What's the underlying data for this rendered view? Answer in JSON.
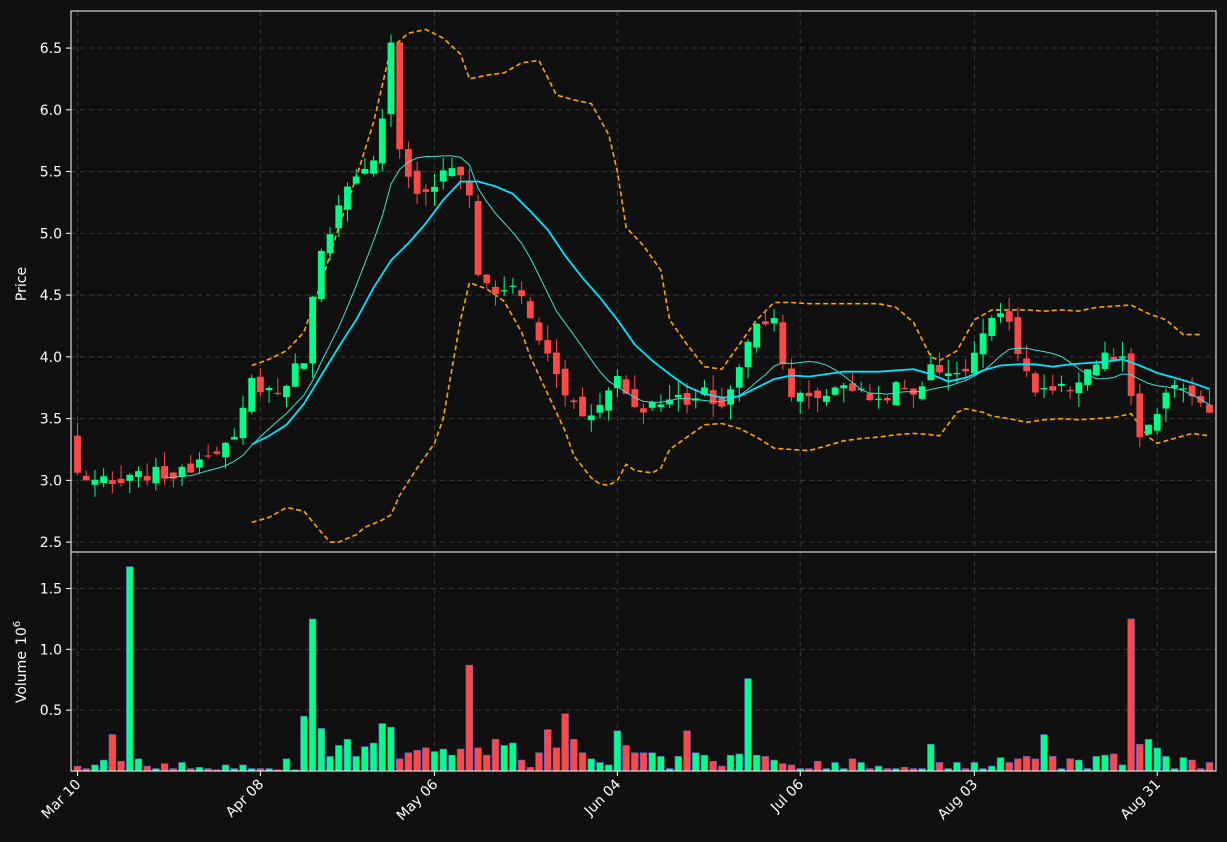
{
  "colors": {
    "background": "#101010",
    "up": "#00ff88",
    "down": "#ff4848",
    "grid": "#3a3a3a",
    "frame": "#ffffff",
    "text": "#ffffff",
    "ma_fast": "#40e0d0",
    "ma_slow": "#00e5ff",
    "bollinger": "#ffa500"
  },
  "chart_data": {
    "type": "candlestick",
    "price_panel": {
      "ylabel": "Price",
      "ylim": [
        2.42,
        6.8
      ],
      "yticks": [
        2.5,
        3.0,
        3.5,
        4.0,
        4.5,
        5.0,
        5.5,
        6.0,
        6.5
      ],
      "ytick_labels": [
        "2.5",
        "3.0",
        "3.5",
        "4.0",
        "4.5",
        "5.0",
        "5.5",
        "6.0",
        "6.5"
      ],
      "grid": true
    },
    "volume_panel": {
      "ylabel": "Volume",
      "ylabel_exponent": "10",
      "ylabel_power": "6",
      "ylim": [
        0,
        1.8
      ],
      "yticks": [
        0.5,
        1.0,
        1.5
      ],
      "ytick_labels": [
        "0.5",
        "1.0",
        "1.5"
      ],
      "grid": true
    },
    "x_ticks": [
      {
        "index": 0,
        "label": "Mar 10"
      },
      {
        "index": 21,
        "label": "Apr 08"
      },
      {
        "index": 41,
        "label": "May 06"
      },
      {
        "index": 62,
        "label": "Jun 04"
      },
      {
        "index": 83,
        "label": "Jul 06"
      },
      {
        "index": 103,
        "label": "Aug 03"
      },
      {
        "index": 124,
        "label": "Aug 31"
      }
    ],
    "n_bars": 131,
    "keypoints": {
      "close": [
        [
          0,
          3.05
        ],
        [
          4,
          2.95
        ],
        [
          8,
          3.05
        ],
        [
          12,
          3.05
        ],
        [
          15,
          3.25
        ],
        [
          18,
          3.3
        ],
        [
          20,
          3.8
        ],
        [
          23,
          3.7
        ],
        [
          26,
          4.0
        ],
        [
          28,
          4.9
        ],
        [
          31,
          5.35
        ],
        [
          34,
          5.55
        ],
        [
          35,
          5.9
        ],
        [
          36,
          6.6
        ],
        [
          37,
          5.7
        ],
        [
          39,
          5.3
        ],
        [
          41,
          5.4
        ],
        [
          43,
          5.55
        ],
        [
          45,
          5.3
        ],
        [
          46,
          4.7
        ],
        [
          48,
          4.5
        ],
        [
          50,
          4.6
        ],
        [
          52,
          4.3
        ],
        [
          54,
          4.0
        ],
        [
          56,
          3.7
        ],
        [
          58,
          3.55
        ],
        [
          60,
          3.6
        ],
        [
          62,
          3.85
        ],
        [
          64,
          3.6
        ],
        [
          66,
          3.6
        ],
        [
          68,
          3.7
        ],
        [
          70,
          3.6
        ],
        [
          72,
          3.7
        ],
        [
          74,
          3.6
        ],
        [
          76,
          3.9
        ],
        [
          78,
          4.3
        ],
        [
          80,
          4.3
        ],
        [
          82,
          3.7
        ],
        [
          84,
          3.65
        ],
        [
          86,
          3.7
        ],
        [
          88,
          3.8
        ],
        [
          90,
          3.7
        ],
        [
          92,
          3.65
        ],
        [
          94,
          3.75
        ],
        [
          96,
          3.7
        ],
        [
          98,
          3.9
        ],
        [
          100,
          3.9
        ],
        [
          102,
          3.85
        ],
        [
          104,
          4.25
        ],
        [
          106,
          4.4
        ],
        [
          108,
          4.05
        ],
        [
          110,
          3.7
        ],
        [
          112,
          3.7
        ],
        [
          114,
          3.75
        ],
        [
          116,
          3.9
        ],
        [
          118,
          4.0
        ],
        [
          120,
          3.95
        ],
        [
          122,
          3.35
        ],
        [
          123,
          3.4
        ],
        [
          124,
          3.55
        ],
        [
          125,
          3.7
        ],
        [
          127,
          3.75
        ],
        [
          128,
          3.7
        ],
        [
          130,
          3.5
        ]
      ],
      "volume_m": [
        [
          0,
          0.04
        ],
        [
          2,
          0.05
        ],
        [
          3,
          0.09
        ],
        [
          4,
          0.3
        ],
        [
          5,
          0.08
        ],
        [
          6,
          1.68
        ],
        [
          7,
          0.1
        ],
        [
          8,
          0.04
        ],
        [
          10,
          0.06
        ],
        [
          12,
          0.07
        ],
        [
          14,
          0.03
        ],
        [
          16,
          0.01
        ],
        [
          17,
          0.05
        ],
        [
          19,
          0.05
        ],
        [
          21,
          0.02
        ],
        [
          23,
          0.01
        ],
        [
          24,
          0.1
        ],
        [
          25,
          0.01
        ],
        [
          26,
          0.45
        ],
        [
          27,
          1.25
        ],
        [
          28,
          0.35
        ],
        [
          29,
          0.12
        ],
        [
          30,
          0.21
        ],
        [
          31,
          0.26
        ],
        [
          32,
          0.12
        ],
        [
          33,
          0.2
        ],
        [
          34,
          0.23
        ],
        [
          35,
          0.39
        ],
        [
          36,
          0.36
        ],
        [
          37,
          0.1
        ],
        [
          38,
          0.15
        ],
        [
          39,
          0.17
        ],
        [
          40,
          0.19
        ],
        [
          41,
          0.16
        ],
        [
          42,
          0.18
        ],
        [
          43,
          0.13
        ],
        [
          44,
          0.18
        ],
        [
          45,
          0.87
        ],
        [
          46,
          0.19
        ],
        [
          47,
          0.13
        ],
        [
          48,
          0.26
        ],
        [
          49,
          0.21
        ],
        [
          50,
          0.23
        ],
        [
          51,
          0.09
        ],
        [
          52,
          0.03
        ],
        [
          53,
          0.15
        ],
        [
          54,
          0.34
        ],
        [
          55,
          0.19
        ],
        [
          56,
          0.47
        ],
        [
          57,
          0.26
        ],
        [
          58,
          0.15
        ],
        [
          59,
          0.1
        ],
        [
          60,
          0.07
        ],
        [
          61,
          0.05
        ],
        [
          62,
          0.33
        ],
        [
          63,
          0.21
        ],
        [
          64,
          0.15
        ],
        [
          65,
          0.15
        ],
        [
          66,
          0.15
        ],
        [
          67,
          0.12
        ],
        [
          69,
          0.12
        ],
        [
          70,
          0.33
        ],
        [
          71,
          0.15
        ],
        [
          72,
          0.13
        ],
        [
          73,
          0.08
        ],
        [
          74,
          0.04
        ],
        [
          75,
          0.13
        ],
        [
          76,
          0.14
        ],
        [
          77,
          0.76
        ],
        [
          78,
          0.13
        ],
        [
          79,
          0.12
        ],
        [
          80,
          0.09
        ],
        [
          81,
          0.06
        ],
        [
          82,
          0.05
        ],
        [
          85,
          0.08
        ],
        [
          87,
          0.07
        ],
        [
          89,
          0.1
        ],
        [
          90,
          0.07
        ],
        [
          92,
          0.04
        ],
        [
          95,
          0.03
        ],
        [
          98,
          0.22
        ],
        [
          99,
          0.07
        ],
        [
          101,
          0.07
        ],
        [
          103,
          0.07
        ],
        [
          105,
          0.04
        ],
        [
          106,
          0.11
        ],
        [
          107,
          0.07
        ],
        [
          108,
          0.1
        ],
        [
          109,
          0.12
        ],
        [
          110,
          0.1
        ],
        [
          111,
          0.3
        ],
        [
          112,
          0.12
        ],
        [
          114,
          0.1
        ],
        [
          115,
          0.09
        ],
        [
          117,
          0.12
        ],
        [
          118,
          0.13
        ],
        [
          119,
          0.14
        ],
        [
          120,
          0.05
        ],
        [
          121,
          1.25
        ],
        [
          122,
          0.22
        ],
        [
          123,
          0.26
        ],
        [
          124,
          0.19
        ],
        [
          125,
          0.12
        ],
        [
          127,
          0.11
        ],
        [
          128,
          0.09
        ],
        [
          130,
          0.07
        ]
      ],
      "mid_band_from_index": 20,
      "mid_band": [
        [
          20,
          3.29
        ],
        [
          22,
          3.36
        ],
        [
          24,
          3.45
        ],
        [
          26,
          3.62
        ],
        [
          28,
          3.85
        ],
        [
          30,
          4.08
        ],
        [
          32,
          4.3
        ],
        [
          34,
          4.56
        ],
        [
          36,
          4.78
        ],
        [
          38,
          4.92
        ],
        [
          40,
          5.08
        ],
        [
          42,
          5.27
        ],
        [
          44,
          5.42
        ],
        [
          46,
          5.42
        ],
        [
          48,
          5.38
        ],
        [
          50,
          5.32
        ],
        [
          52,
          5.18
        ],
        [
          54,
          5.03
        ],
        [
          56,
          4.82
        ],
        [
          58,
          4.64
        ],
        [
          60,
          4.48
        ],
        [
          62,
          4.3
        ],
        [
          64,
          4.1
        ],
        [
          66,
          3.97
        ],
        [
          68,
          3.86
        ],
        [
          70,
          3.76
        ],
        [
          72,
          3.7
        ],
        [
          74,
          3.67
        ],
        [
          76,
          3.68
        ],
        [
          78,
          3.75
        ],
        [
          80,
          3.82
        ],
        [
          82,
          3.85
        ],
        [
          84,
          3.84
        ],
        [
          86,
          3.86
        ],
        [
          88,
          3.88
        ],
        [
          90,
          3.88
        ],
        [
          92,
          3.88
        ],
        [
          94,
          3.89
        ],
        [
          96,
          3.9
        ],
        [
          98,
          3.86
        ],
        [
          100,
          3.8
        ],
        [
          102,
          3.83
        ],
        [
          104,
          3.89
        ],
        [
          106,
          3.93
        ],
        [
          108,
          3.94
        ],
        [
          110,
          3.94
        ],
        [
          112,
          3.92
        ],
        [
          114,
          3.94
        ],
        [
          116,
          3.95
        ],
        [
          118,
          3.96
        ],
        [
          120,
          3.98
        ],
        [
          122,
          3.93
        ],
        [
          124,
          3.87
        ],
        [
          126,
          3.83
        ],
        [
          128,
          3.79
        ],
        [
          130,
          3.74
        ]
      ],
      "upper_band": [
        [
          20,
          3.93
        ],
        [
          22,
          3.98
        ],
        [
          24,
          4.05
        ],
        [
          26,
          4.2
        ],
        [
          28,
          4.6
        ],
        [
          30,
          5.05
        ],
        [
          32,
          5.45
        ],
        [
          34,
          5.9
        ],
        [
          36,
          6.5
        ],
        [
          38,
          6.62
        ],
        [
          40,
          6.65
        ],
        [
          42,
          6.58
        ],
        [
          44,
          6.45
        ],
        [
          45,
          6.25
        ],
        [
          47,
          6.28
        ],
        [
          49,
          6.3
        ],
        [
          51,
          6.38
        ],
        [
          53,
          6.4
        ],
        [
          55,
          6.12
        ],
        [
          57,
          6.08
        ],
        [
          59,
          6.05
        ],
        [
          61,
          5.8
        ],
        [
          62,
          5.5
        ],
        [
          63,
          5.05
        ],
        [
          65,
          4.9
        ],
        [
          67,
          4.7
        ],
        [
          68,
          4.3
        ],
        [
          70,
          4.1
        ],
        [
          72,
          3.92
        ],
        [
          74,
          3.9
        ],
        [
          76,
          4.1
        ],
        [
          78,
          4.3
        ],
        [
          80,
          4.44
        ],
        [
          82,
          4.44
        ],
        [
          84,
          4.43
        ],
        [
          86,
          4.43
        ],
        [
          88,
          4.43
        ],
        [
          90,
          4.43
        ],
        [
          92,
          4.43
        ],
        [
          94,
          4.4
        ],
        [
          96,
          4.28
        ],
        [
          98,
          4.0
        ],
        [
          99,
          3.97
        ],
        [
          101,
          4.05
        ],
        [
          103,
          4.3
        ],
        [
          105,
          4.38
        ],
        [
          107,
          4.38
        ],
        [
          109,
          4.38
        ],
        [
          111,
          4.37
        ],
        [
          113,
          4.38
        ],
        [
          115,
          4.37
        ],
        [
          117,
          4.4
        ],
        [
          119,
          4.41
        ],
        [
          121,
          4.42
        ],
        [
          123,
          4.35
        ],
        [
          125,
          4.3
        ],
        [
          127,
          4.18
        ],
        [
          129,
          4.18
        ]
      ],
      "lower_band": [
        [
          20,
          2.66
        ],
        [
          22,
          2.7
        ],
        [
          24,
          2.78
        ],
        [
          26,
          2.75
        ],
        [
          28,
          2.58
        ],
        [
          29,
          2.5
        ],
        [
          30,
          2.5
        ],
        [
          32,
          2.56
        ],
        [
          33,
          2.62
        ],
        [
          35,
          2.68
        ],
        [
          36,
          2.72
        ],
        [
          37,
          2.88
        ],
        [
          39,
          3.1
        ],
        [
          40,
          3.2
        ],
        [
          41,
          3.3
        ],
        [
          42,
          3.5
        ],
        [
          43,
          3.9
        ],
        [
          44,
          4.3
        ],
        [
          45,
          4.6
        ],
        [
          47,
          4.55
        ],
        [
          49,
          4.45
        ],
        [
          51,
          4.2
        ],
        [
          52,
          4.0
        ],
        [
          54,
          3.7
        ],
        [
          56,
          3.4
        ],
        [
          57,
          3.2
        ],
        [
          59,
          3.02
        ],
        [
          60,
          2.97
        ],
        [
          61,
          2.96
        ],
        [
          62,
          3.0
        ],
        [
          63,
          3.13
        ],
        [
          64,
          3.08
        ],
        [
          66,
          3.06
        ],
        [
          67,
          3.1
        ],
        [
          68,
          3.25
        ],
        [
          70,
          3.35
        ],
        [
          72,
          3.45
        ],
        [
          74,
          3.46
        ],
        [
          76,
          3.42
        ],
        [
          78,
          3.35
        ],
        [
          80,
          3.26
        ],
        [
          82,
          3.25
        ],
        [
          84,
          3.24
        ],
        [
          86,
          3.28
        ],
        [
          88,
          3.32
        ],
        [
          90,
          3.34
        ],
        [
          92,
          3.35
        ],
        [
          94,
          3.37
        ],
        [
          96,
          3.38
        ],
        [
          98,
          3.37
        ],
        [
          99,
          3.36
        ],
        [
          101,
          3.55
        ],
        [
          102,
          3.58
        ],
        [
          104,
          3.55
        ],
        [
          105,
          3.52
        ],
        [
          107,
          3.5
        ],
        [
          109,
          3.47
        ],
        [
          111,
          3.49
        ],
        [
          113,
          3.5
        ],
        [
          115,
          3.49
        ],
        [
          117,
          3.5
        ],
        [
          119,
          3.51
        ],
        [
          121,
          3.54
        ],
        [
          123,
          3.35
        ],
        [
          124,
          3.3
        ],
        [
          126,
          3.34
        ],
        [
          128,
          3.38
        ],
        [
          130,
          3.36
        ]
      ]
    }
  }
}
